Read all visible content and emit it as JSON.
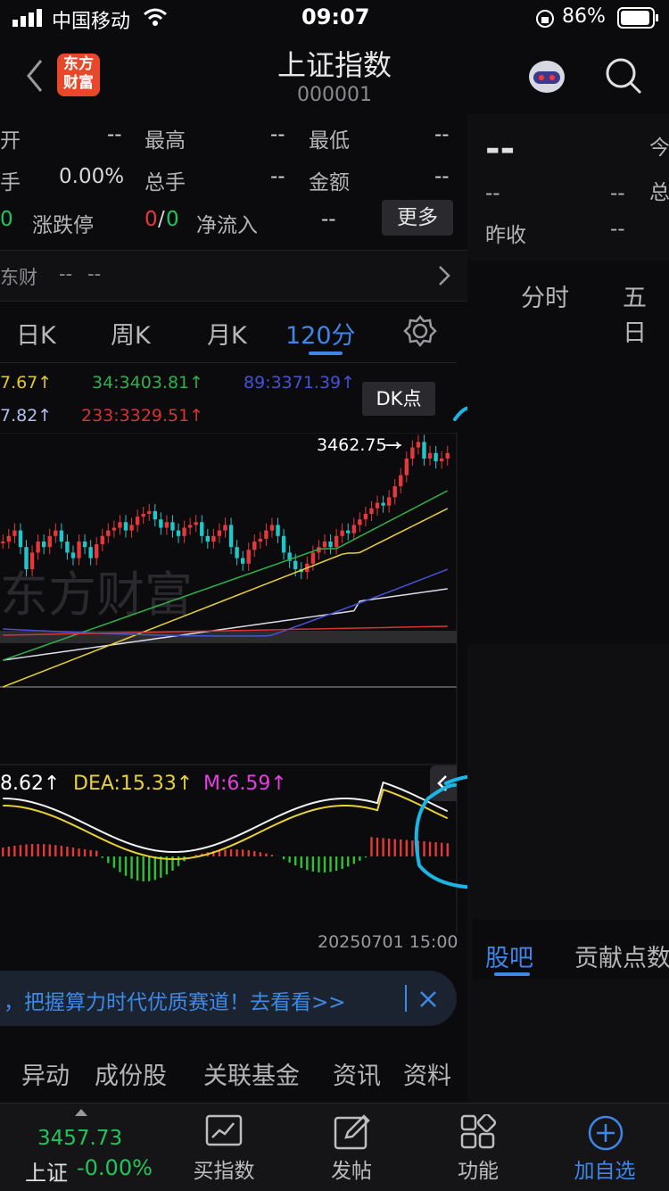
{
  "status": {
    "carrier": "中国移动",
    "time": "09:07",
    "battery": "86%"
  },
  "header": {
    "title": "上证指数",
    "code": "000001",
    "logo": "东方财富"
  },
  "stats": {
    "open_label": "开",
    "open_value": "--",
    "high_label": "最高",
    "high_value": "--",
    "low_label": "最低",
    "low_value": "--",
    "turnover_label": "手",
    "turnover_value": "0.00%",
    "volume_label": "总手",
    "volume_value": "--",
    "amount_label": "金额",
    "amount_value": "--",
    "updown_prefix": "0",
    "updown_label": "涨跌停",
    "updown_up": "0",
    "updown_sep": "/",
    "updown_down": "0",
    "netflow_label": "净流入",
    "netflow_value": "--",
    "more_label": "更多"
  },
  "dfbar": {
    "label": "东财",
    "v1": "--",
    "v2": "--"
  },
  "chart_tabs": [
    "日K",
    "周K",
    "月K",
    "120分"
  ],
  "ma": {
    "a": "7.67↑",
    "b": "34:3403.81↑",
    "c": "89:3371.39↑",
    "d": "7.82↑",
    "e": "233:3329.51↑"
  },
  "dk_label": "DK点",
  "price_marker": "3462.75",
  "macd": {
    "dif": "8.62↑",
    "dea": "DEA:15.33↑",
    "m": "M:6.59↑"
  },
  "date_label": "20250701 15:00",
  "banner": {
    "text": "，把握算力时代优质赛道！去看看>>"
  },
  "bottom_tabs": [
    "异动",
    "成份股",
    "关联基金",
    "资讯",
    "资料"
  ],
  "right": {
    "price": "--",
    "chg": "--",
    "pct": "--",
    "today_label": "今",
    "total_label": "总",
    "prev_label": "昨收",
    "prev_value": "--",
    "tab1": "分时",
    "tab2": "五日",
    "guba": "股吧",
    "contrib": "贡献点数"
  },
  "nav": {
    "index_price": "3457.73",
    "index_name": "上证",
    "index_pct": "-0.00%",
    "buy": "买指数",
    "post": "发帖",
    "func": "功能",
    "add": "加自选"
  },
  "chart_data": {
    "type": "candlestick",
    "title": "上证指数 120分",
    "marked_price": 3462.75,
    "ma": {
      "34": 3403.81,
      "89": 3371.39,
      "233": 3329.51
    },
    "macd": {
      "dea": 15.33,
      "m": 6.59
    },
    "last_time": "20250701 15:00"
  },
  "colors": {
    "up": "#e6383a",
    "down": "#1ec7c9",
    "accent": "#3f86e8",
    "annotation": "#19b6e6"
  }
}
